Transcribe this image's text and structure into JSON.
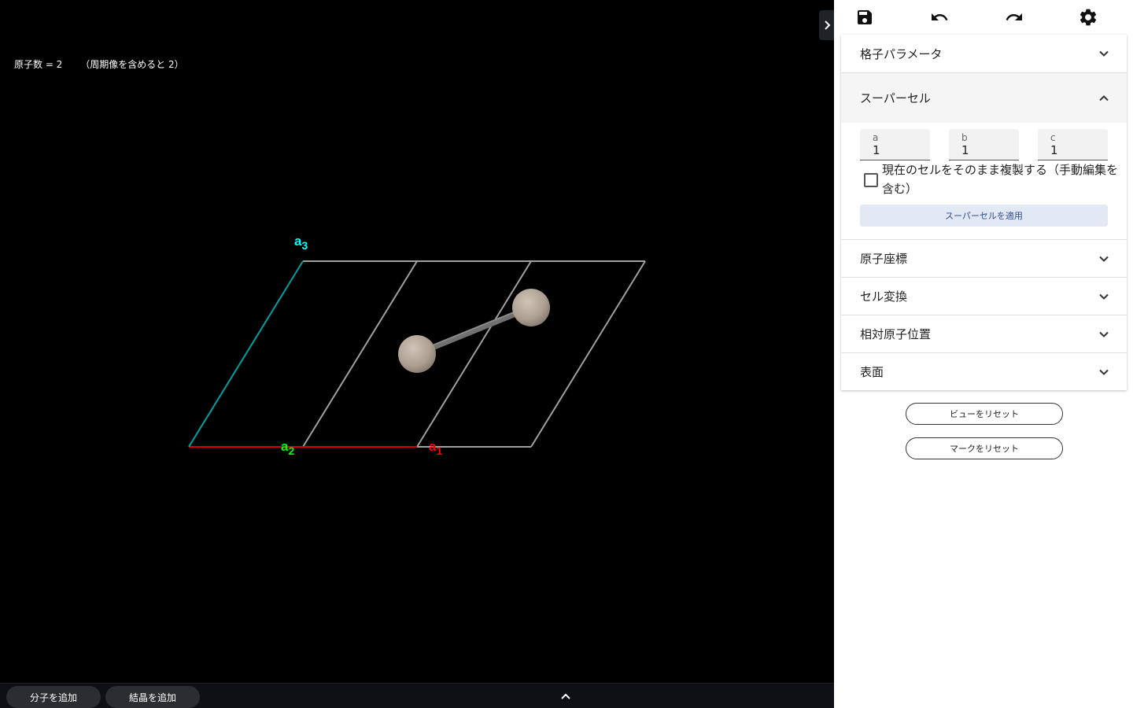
{
  "viewer": {
    "atom_count_text": "原子数 = 2      （周期像を含めると 2）",
    "axis_labels": {
      "a1": {
        "base": "a",
        "sub": "1",
        "color": "#ff0000"
      },
      "a2": {
        "base": "a",
        "sub": "2",
        "color": "#00ff00"
      },
      "a3": {
        "base": "a",
        "sub": "3",
        "color": "#00ffff"
      }
    },
    "colors": {
      "background": "#000000",
      "cell_edges": "#a0a0a0",
      "a1_axis": "#cc0000",
      "a3_axis": "#00a0a0",
      "atom": "#b8ab9d",
      "bond": "#707070"
    }
  },
  "bottom_bar": {
    "add_molecule_label": "分子を追加",
    "add_crystal_label": "結晶を追加",
    "expand_icon": "chevron-up-icon"
  },
  "toolbar": {
    "icons": [
      "save-icon",
      "undo-icon",
      "redo-icon",
      "settings-icon"
    ]
  },
  "panel": {
    "sections": {
      "lattice_params": "格子パラメータ",
      "supercell": "スーパーセル",
      "atomic_coords": "原子座標",
      "cell_transform": "セル変換",
      "relative_positions": "相対原子位置",
      "surface": "表面"
    },
    "supercell": {
      "a_label": "a",
      "a_value": "1",
      "b_label": "b",
      "b_value": "1",
      "c_label": "c",
      "c_value": "1",
      "copy_checkbox_label": "現在のセルをそのまま複製する（手動編集を含む）",
      "copy_checked": false,
      "apply_label": "スーパーセルを適用"
    },
    "reset_view_label": "ビューをリセット",
    "reset_marks_label": "マークをリセット"
  }
}
